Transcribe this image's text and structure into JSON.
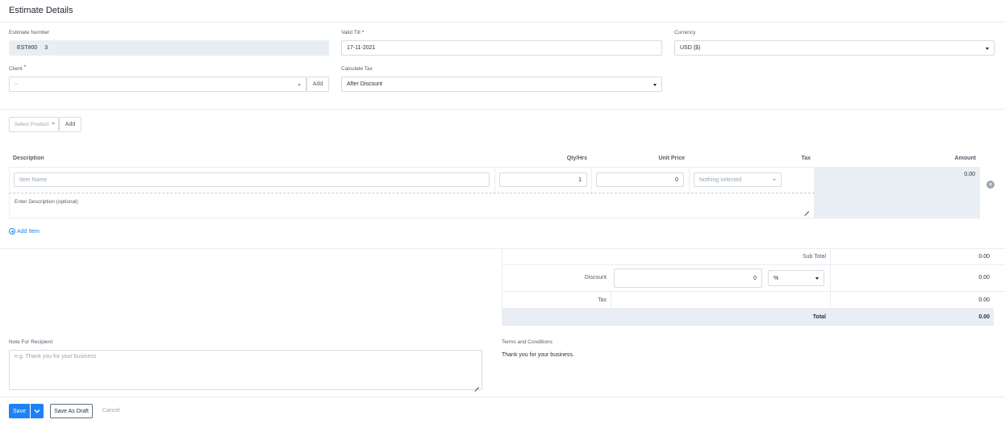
{
  "page": {
    "title": "Estimate Details"
  },
  "form": {
    "estimate_number": {
      "label": "Estimate Number",
      "prefix": "EST#00",
      "value": "3"
    },
    "valid_till": {
      "label": "Valid Till",
      "required": "*",
      "value": "17-11-2021"
    },
    "currency": {
      "label": "Currency",
      "value": "USD ($)"
    },
    "client": {
      "label": "Client",
      "required": "*",
      "value": "--",
      "add_label": "Add"
    },
    "calculate_tax": {
      "label": "Calculate Tax",
      "value": "After Discount"
    }
  },
  "product": {
    "placeholder": "Select Product",
    "add_label": "Add"
  },
  "items_table": {
    "headers": {
      "description": "Description",
      "qty": "Qty/Hrs",
      "unit_price": "Unit Price",
      "tax": "Tax",
      "amount": "Amount"
    },
    "row": {
      "item_name_placeholder": "Item Name",
      "qty": "1",
      "unit_price": "0",
      "tax_placeholder": "Nothing selected",
      "amount": "0.00",
      "description_placeholder": "Enter Description (optional)"
    },
    "add_item_label": "Add Item"
  },
  "totals": {
    "sub_total_label": "Sub Total",
    "sub_total": "0.00",
    "discount_label": "Discount",
    "discount_value": "0",
    "discount_type": "%",
    "discount_amount": "0.00",
    "tax_label": "Tax",
    "tax_amount": "0.00",
    "total_label": "Total",
    "total": "0.00"
  },
  "note": {
    "label": "Note For Recipient",
    "placeholder": "e.g. Thank you for your business"
  },
  "terms": {
    "label": "Terms and Conditions",
    "value": "Thank you for your business."
  },
  "actions": {
    "save": "Save",
    "save_draft": "Save As Draft",
    "cancel": "Cancel"
  },
  "colors": {
    "primary": "#1d82f5",
    "required": "#d30000",
    "grey_bg": "#e8eef3"
  },
  "icons": {
    "add_item": "plus-circle-icon",
    "remove_row": "close-circle-icon",
    "save_menu": "chevron-down-icon"
  }
}
